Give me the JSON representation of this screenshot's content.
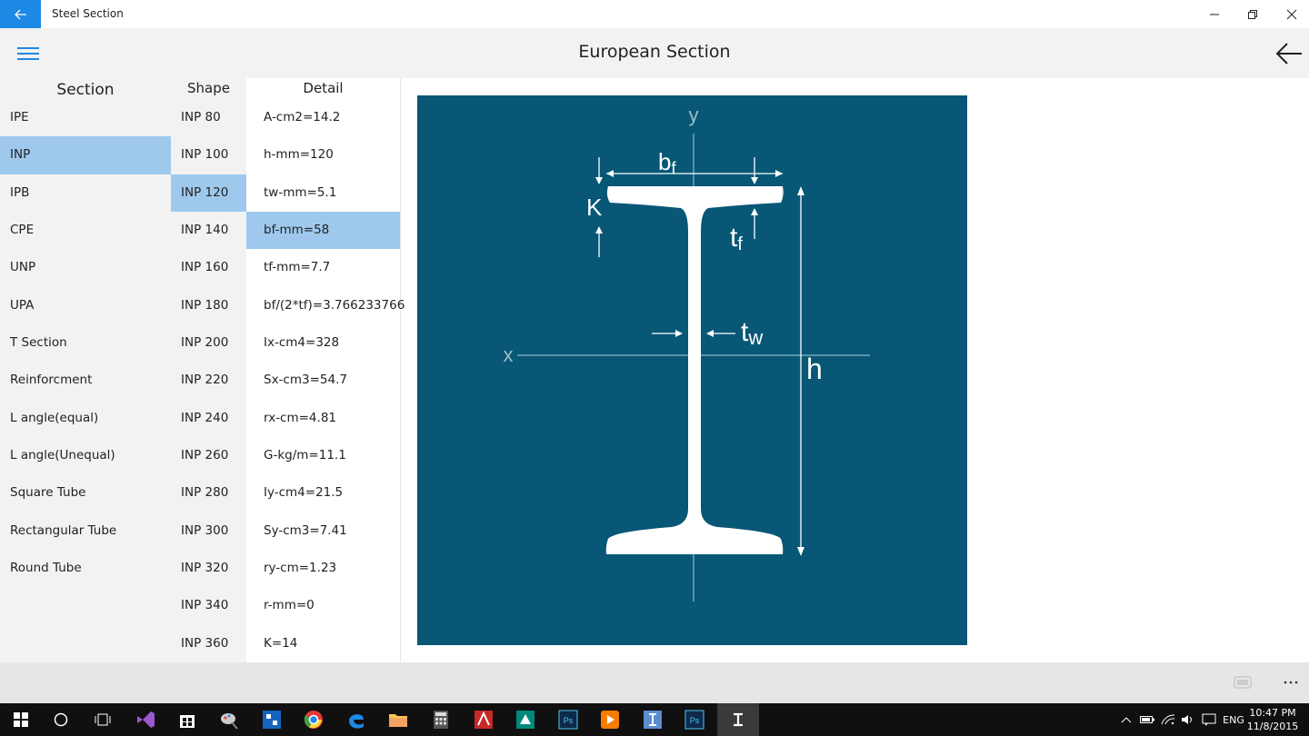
{
  "window": {
    "title": "Steel Section"
  },
  "header": {
    "title": "European Section"
  },
  "columns": {
    "section": "Section",
    "shape": "Shape",
    "detail": "Detail"
  },
  "sections": [
    {
      "label": "IPE",
      "selected": false
    },
    {
      "label": "INP",
      "selected": true
    },
    {
      "label": "IPB",
      "selected": false
    },
    {
      "label": "CPE",
      "selected": false
    },
    {
      "label": "UNP",
      "selected": false
    },
    {
      "label": "UPA",
      "selected": false
    },
    {
      "label": "T Section",
      "selected": false
    },
    {
      "label": "Reinforcment",
      "selected": false
    },
    {
      "label": "L angle(equal)",
      "selected": false
    },
    {
      "label": "L angle(Unequal)",
      "selected": false
    },
    {
      "label": "Square Tube",
      "selected": false
    },
    {
      "label": "Rectangular Tube",
      "selected": false
    },
    {
      "label": "Round Tube",
      "selected": false
    }
  ],
  "shapes": [
    {
      "label": "INP 80",
      "selected": false
    },
    {
      "label": "INP 100",
      "selected": false
    },
    {
      "label": "INP 120",
      "selected": true
    },
    {
      "label": "INP 140",
      "selected": false
    },
    {
      "label": "INP 160",
      "selected": false
    },
    {
      "label": "INP 180",
      "selected": false
    },
    {
      "label": "INP 200",
      "selected": false
    },
    {
      "label": "INP 220",
      "selected": false
    },
    {
      "label": "INP 240",
      "selected": false
    },
    {
      "label": "INP 260",
      "selected": false
    },
    {
      "label": "INP 280",
      "selected": false
    },
    {
      "label": "INP 300",
      "selected": false
    },
    {
      "label": "INP 320",
      "selected": false
    },
    {
      "label": "INP 340",
      "selected": false
    },
    {
      "label": "INP 360",
      "selected": false
    }
  ],
  "details": [
    {
      "label": "A-cm2=14.2",
      "selected": false
    },
    {
      "label": "h-mm=120",
      "selected": false
    },
    {
      "label": "tw-mm=5.1",
      "selected": false
    },
    {
      "label": "bf-mm=58",
      "selected": true
    },
    {
      "label": "tf-mm=7.7",
      "selected": false
    },
    {
      "label": "bf/(2*tf)=3.766233766",
      "selected": false
    },
    {
      "label": "Ix-cm4=328",
      "selected": false
    },
    {
      "label": "Sx-cm3=54.7",
      "selected": false
    },
    {
      "label": "rx-cm=4.81",
      "selected": false
    },
    {
      "label": "G-kg/m=11.1",
      "selected": false
    },
    {
      "label": "Iy-cm4=21.5",
      "selected": false
    },
    {
      "label": "Sy-cm3=7.41",
      "selected": false
    },
    {
      "label": "ry-cm=1.23",
      "selected": false
    },
    {
      "label": "r-mm=0",
      "selected": false
    },
    {
      "label": "K=14",
      "selected": false
    }
  ],
  "figure": {
    "labels": {
      "y": "y",
      "x": "x",
      "bf_main": "b",
      "bf_sub": "f",
      "k": "K",
      "tf_main": "t",
      "tf_sub": "f",
      "tw_main": "t",
      "tw_sub": "w",
      "h": "h"
    },
    "background": "#085776"
  },
  "taskbar": {
    "language": "ENG",
    "time": "10:47 PM",
    "date": "11/8/2015"
  },
  "colors": {
    "accent": "#1e88e5",
    "selection": "#9ec9ed"
  },
  "icons": [
    "back-arrow-icon",
    "minimize-icon",
    "restore-icon",
    "close-icon",
    "hamburger-icon",
    "windows-start-icon",
    "search-circle-icon",
    "task-view-icon",
    "visual-studio-icon",
    "store-icon",
    "paint-icon",
    "app-icon",
    "chrome-icon",
    "edge-icon",
    "file-explorer-icon",
    "calculator-icon",
    "autocad-icon",
    "app-icon",
    "photoshop-icon",
    "media-player-icon",
    "app-icon",
    "photoshop-icon",
    "steel-section-icon"
  ]
}
